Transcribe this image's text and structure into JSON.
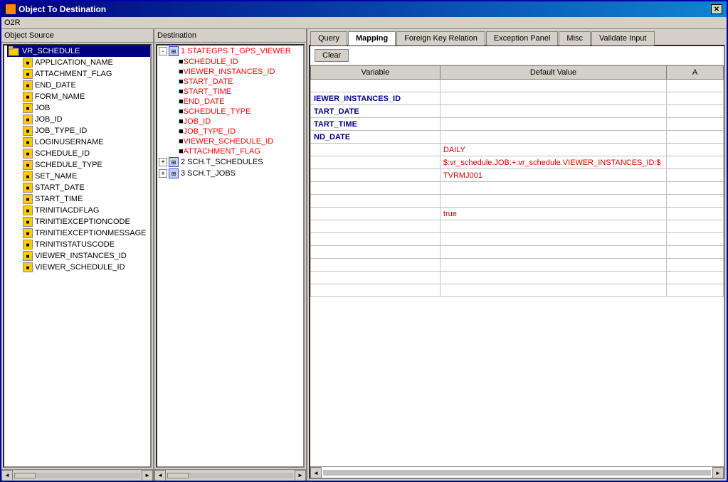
{
  "window": {
    "title": "Object To Destination",
    "menu_item": "O2R"
  },
  "left_panel": {
    "header": "Object Source",
    "tree_root": "VR_SCHEDULE",
    "tree_items": [
      "APPLICATION_NAME",
      "ATTACHMENT_FLAG",
      "END_DATE",
      "FORM_NAME",
      "JOB",
      "JOB_ID",
      "JOB_TYPE_ID",
      "LOGINUSERNAME",
      "SCHEDULE_ID",
      "SCHEDULE_TYPE",
      "SET_NAME",
      "START_DATE",
      "START_TIME",
      "TRINITIACDFLAG",
      "TRINITIEXCEPTIONCODE",
      "TRINITIEXCEPTIONMESSAGE",
      "TRINITISTATUSCODE",
      "VIEWER_INSTANCES_ID",
      "VIEWER_SCHEDULE_ID"
    ]
  },
  "middle_panel": {
    "header": "Destination",
    "tables": [
      {
        "id": "1",
        "name": "STATEGPS.T_GPS_VIEWER",
        "expanded": true,
        "fields": [
          "SCHEDULE_ID",
          "VIEWER_INSTANCES_ID",
          "START_DATE",
          "START_TIME",
          "END_DATE",
          "SCHEDULE_TYPE",
          "JOB_ID",
          "JOB_TYPE_ID",
          "VIEWER_SCHEDULE_ID",
          "ATTACHMENT_FLAG"
        ]
      },
      {
        "id": "2",
        "name": "SCH.T_SCHEDULES",
        "expanded": false,
        "fields": []
      },
      {
        "id": "3",
        "name": "SCH.T_JOBS",
        "expanded": false,
        "fields": []
      }
    ]
  },
  "tabs": [
    {
      "id": "query",
      "label": "Query",
      "active": false
    },
    {
      "id": "mapping",
      "label": "Mapping",
      "active": true
    },
    {
      "id": "foreign_key",
      "label": "Foreign Key Relation",
      "active": false
    },
    {
      "id": "exception",
      "label": "Exception Panel",
      "active": false
    },
    {
      "id": "misc",
      "label": "Misc",
      "active": false
    },
    {
      "id": "validate",
      "label": "Validate Input",
      "active": false
    }
  ],
  "toolbar": {
    "clear_label": "Clear"
  },
  "grid": {
    "col_variable": "Variable",
    "col_default": "Default Value",
    "col_extra": "A",
    "rows": [
      {
        "variable": "",
        "default_value": "",
        "extra": ""
      },
      {
        "variable": "IEWER_INSTANCES_ID",
        "default_value": "",
        "extra": ""
      },
      {
        "variable": "TART_DATE",
        "default_value": "",
        "extra": ""
      },
      {
        "variable": "TART_TIME",
        "default_value": "",
        "extra": ""
      },
      {
        "variable": "ND_DATE",
        "default_value": "",
        "extra": ""
      },
      {
        "variable": "",
        "default_value": "DAILY",
        "extra": ""
      },
      {
        "variable": "",
        "default_value": "$:vr_schedule.JOB:+:vr_schedule.VIEWER_INSTANCES_ID:$",
        "extra": ""
      },
      {
        "variable": "",
        "default_value": "TVRMJ001",
        "extra": ""
      },
      {
        "variable": "",
        "default_value": "",
        "extra": ""
      },
      {
        "variable": "",
        "default_value": "",
        "extra": ""
      },
      {
        "variable": "",
        "default_value": "true",
        "extra": ""
      }
    ]
  }
}
